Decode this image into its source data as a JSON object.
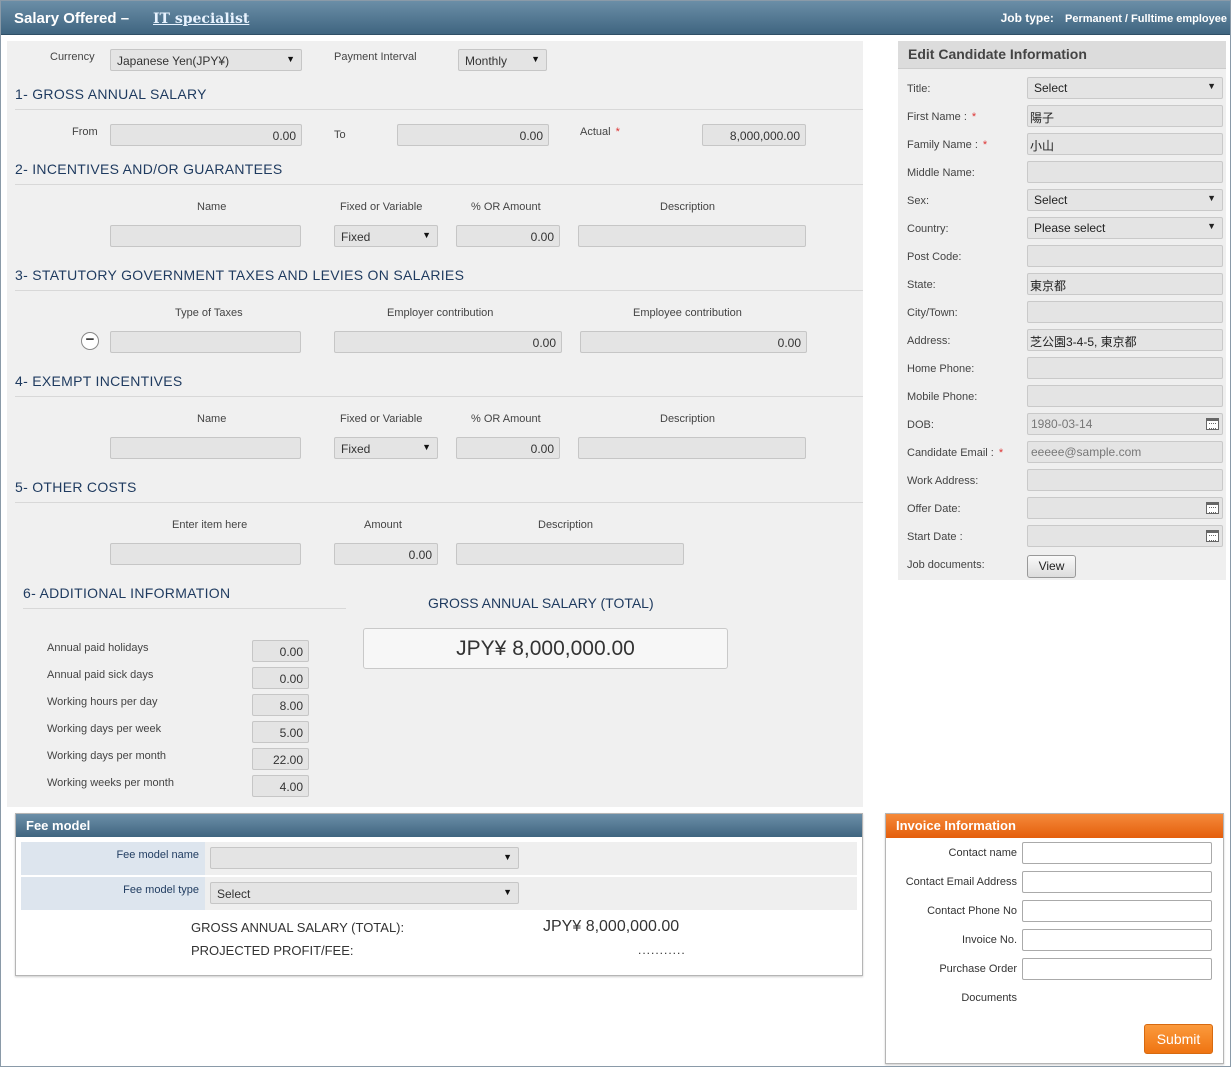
{
  "header": {
    "title": "Salary Offered –",
    "job_title": "IT specialist",
    "job_type_label": "Job type:",
    "job_type_value": "Permanent / Fulltime employee"
  },
  "currency": {
    "label": "Currency",
    "value": "Japanese Yen(JPY¥)"
  },
  "payment_interval": {
    "label": "Payment Interval",
    "value": "Monthly"
  },
  "gross": {
    "title": "1- GROSS ANNUAL SALARY",
    "from_label": "From",
    "from_value": "0.00",
    "to_label": "To",
    "to_value": "0.00",
    "actual_label": "Actual",
    "required": "*",
    "actual_value": "8,000,000.00"
  },
  "incentives": {
    "title": "2- INCENTIVES AND/OR GUARANTEES",
    "headers": {
      "name": "Name",
      "fixed": "Fixed or Variable",
      "amount": "% OR Amount",
      "description": "Description"
    },
    "fixed_value": "Fixed",
    "amount_value": "0.00"
  },
  "taxes": {
    "title": "3- STATUTORY GOVERNMENT TAXES AND LEVIES ON SALARIES",
    "headers": {
      "type": "Type of Taxes",
      "employer": "Employer contribution",
      "employee": "Employee contribution"
    },
    "employer_value": "0.00",
    "employee_value": "0.00",
    "remove_glyph": "−"
  },
  "exempt": {
    "title": "4- EXEMPT INCENTIVES",
    "headers": {
      "name": "Name",
      "fixed": "Fixed or Variable",
      "amount": "% OR Amount",
      "description": "Description"
    },
    "fixed_value": "Fixed",
    "amount_value": "0.00"
  },
  "other_costs": {
    "title": "5- OTHER COSTS",
    "headers": {
      "item": "Enter item here",
      "amount": "Amount",
      "description": "Description"
    },
    "amount_value": "0.00"
  },
  "additional": {
    "title": "6- ADDITIONAL INFORMATION",
    "rows": [
      {
        "label": "Annual paid holidays",
        "value": "0.00"
      },
      {
        "label": "Annual paid sick days",
        "value": "0.00"
      },
      {
        "label": "Working hours per day",
        "value": "8.00"
      },
      {
        "label": "Working days per week",
        "value": "5.00"
      },
      {
        "label": "Working days per month",
        "value": "22.00"
      },
      {
        "label": "Working weeks per month",
        "value": "4.00"
      }
    ]
  },
  "gross_total": {
    "title": "GROSS ANNUAL SALARY (TOTAL)",
    "value": "JPY¥ 8,000,000.00"
  },
  "candidate": {
    "title": "Edit Candidate Information",
    "required": "*",
    "fields": {
      "title": {
        "label": "Title:",
        "value": "Select"
      },
      "first_name": {
        "label": "First Name :",
        "value": "陽子"
      },
      "family_name": {
        "label": "Family Name :",
        "value": "小山"
      },
      "middle_name": {
        "label": "Middle Name:",
        "value": ""
      },
      "sex": {
        "label": "Sex:",
        "value": "Select"
      },
      "country": {
        "label": "Country:",
        "value": "Please select"
      },
      "post_code": {
        "label": "Post Code:",
        "value": ""
      },
      "state": {
        "label": "State:",
        "value": "東京都"
      },
      "city": {
        "label": "City/Town:",
        "value": ""
      },
      "address": {
        "label": "Address:",
        "value": "芝公園3-4-5, 東京都"
      },
      "home_phone": {
        "label": "Home Phone:",
        "value": ""
      },
      "mobile_phone": {
        "label": "Mobile Phone:",
        "value": ""
      },
      "dob": {
        "label": "DOB:",
        "value": "1980-03-14"
      },
      "email": {
        "label": "Candidate Email :",
        "value": "eeeee@sample.com"
      },
      "work_address": {
        "label": "Work Address:",
        "value": ""
      },
      "offer_date": {
        "label": "Offer Date:",
        "value": ""
      },
      "start_date": {
        "label": "Start Date :",
        "value": ""
      },
      "job_documents": {
        "label": "Job documents:",
        "button": "View"
      }
    }
  },
  "fee_model": {
    "title": "Fee model",
    "name_label": "Fee model name",
    "name_value": "",
    "type_label": "Fee model type",
    "type_value": "Select",
    "gross_label": "GROSS ANNUAL SALARY (TOTAL):",
    "gross_value": "JPY¥ 8,000,000.00",
    "profit_label": "PROJECTED PROFIT/FEE:",
    "profit_value": "..........."
  },
  "invoice": {
    "title": "Invoice Information",
    "fields": [
      {
        "label": "Contact name"
      },
      {
        "label": "Contact Email Address"
      },
      {
        "label": "Contact Phone No"
      },
      {
        "label": "Invoice No."
      },
      {
        "label": "Purchase Order"
      }
    ],
    "documents_label": "Documents",
    "submit": "Submit"
  }
}
